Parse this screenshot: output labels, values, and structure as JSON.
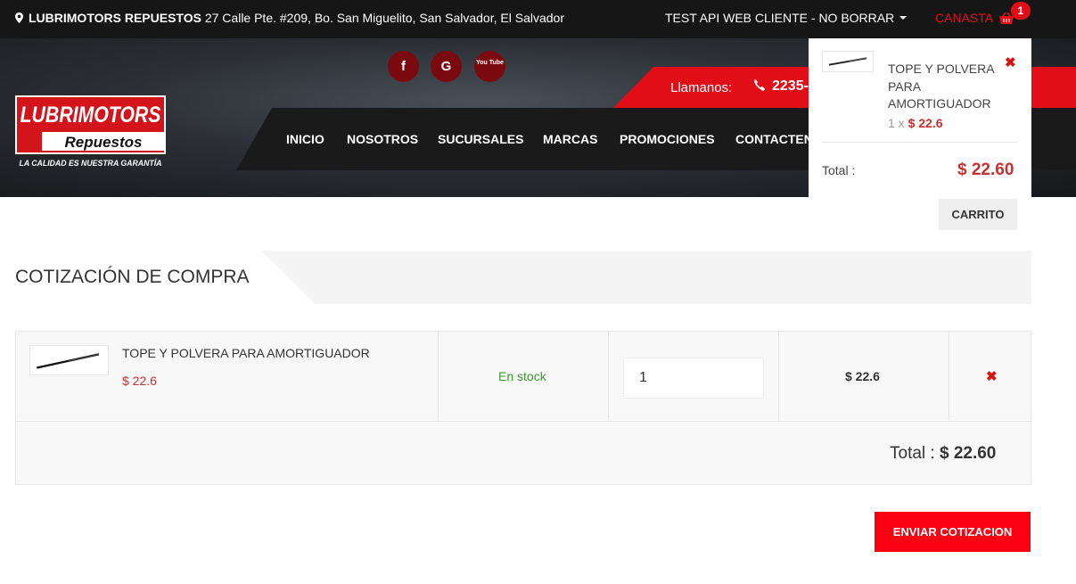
{
  "topbar": {
    "store_name": "LUBRIMOTORS REPUESTOS",
    "address": "27 Calle Pte. #209, Bo. San Miguelito, San Salvador, El Salvador",
    "user_label": "TEST API WEB CLIENTE - NO BORRAR",
    "cart_label": "CANASTA",
    "cart_count": "1"
  },
  "logo": {
    "line1": "LUBRIMOTORS",
    "line2": "Repuestos",
    "tagline": "LA CALIDAD ES NUESTRA GARANTÍA"
  },
  "social": [
    "f",
    "G",
    "You Tube"
  ],
  "callbar": {
    "label": "Llamanos:",
    "phone": "2235-"
  },
  "nav": {
    "items": [
      "INICIO",
      "NOSOTROS",
      "SUCURSALES",
      "MARCAS",
      "PROMOCIONES",
      "CONTACTEN"
    ]
  },
  "minicart": {
    "product_name": "TOPE Y POLVERA PARA AMORTIGUADOR",
    "qty_prefix": "1 x",
    "qty_price": "$ 22.6",
    "total_label": "Total :",
    "total_value": "$ 22.60",
    "button": "CARRITO"
  },
  "page": {
    "title": "COTIZACIÓN DE COMPRA"
  },
  "cart": {
    "items": [
      {
        "name": "TOPE Y POLVERA PARA AMORTIGUADOR",
        "price": "$ 22.6",
        "stock": "En stock",
        "qty": "1",
        "line_total": "$ 22.6"
      }
    ],
    "total_label": "Total :",
    "total_value": "$ 22.60"
  },
  "actions": {
    "send": "ENVIAR COTIZACION"
  },
  "colors": {
    "brand_red": "#e20e17",
    "price_red": "#c9302c",
    "stock_green": "#3c9a2f"
  }
}
